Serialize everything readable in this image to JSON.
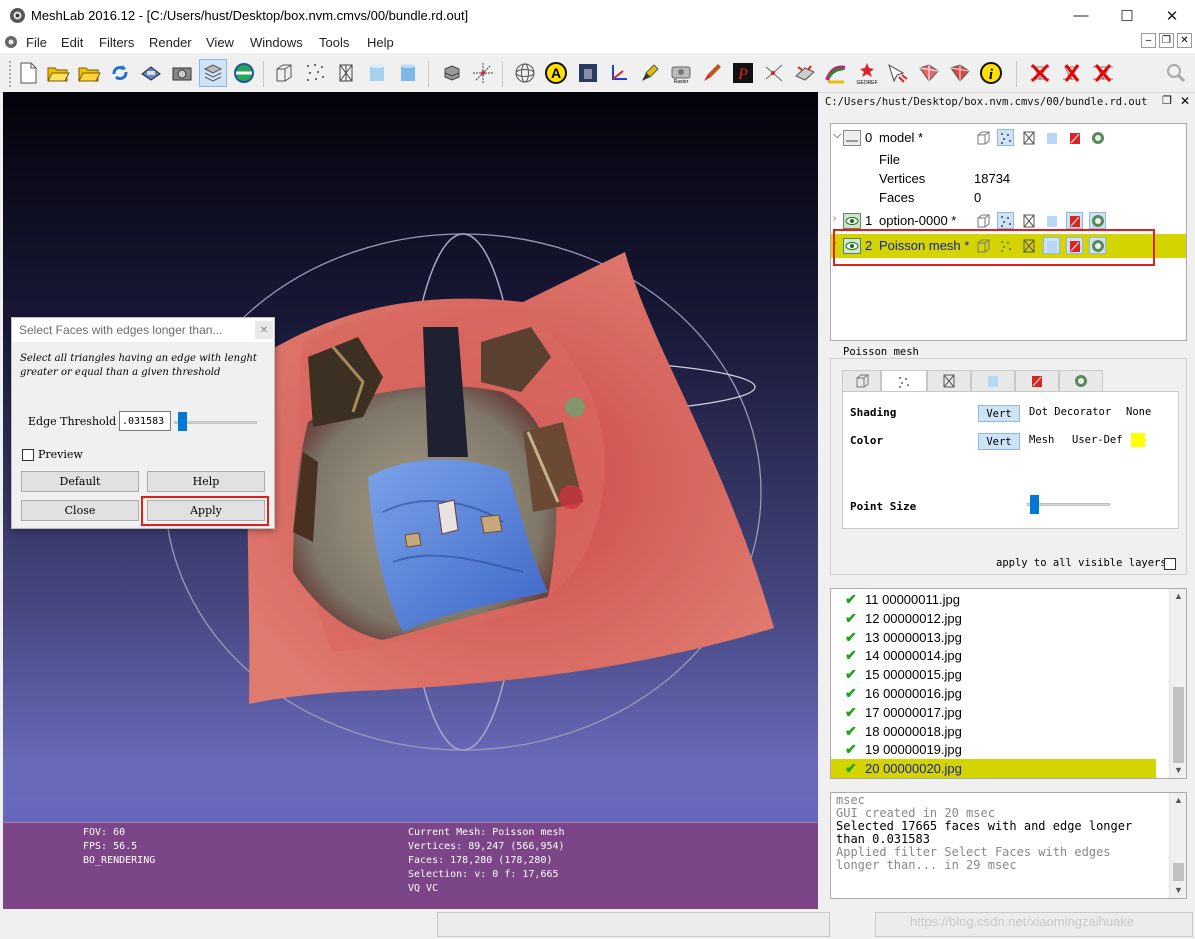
{
  "window": {
    "title": "MeshLab 2016.12 - [C:/Users/hust/Desktop/box.nvm.cmvs/00/bundle.rd.out]"
  },
  "menu": [
    "File",
    "Edit",
    "Filters",
    "Render",
    "View",
    "Windows",
    "Tools",
    "Help"
  ],
  "mdi_controls": [
    "–",
    "❐",
    "✕"
  ],
  "dialog": {
    "title": "Select Faces with edges longer than...",
    "close_glyph": "✕",
    "description": "Select all triangles having an edge with lenght greater or equal than a given threshold",
    "threshold_label": "Edge Threshold",
    "threshold_value": ".031583",
    "slider_fraction": 0.05,
    "preview_label": "Preview",
    "preview_checked": false,
    "default_label": "Default",
    "help_label": "Help",
    "close_label": "Close",
    "apply_label": "Apply"
  },
  "viewport_info": {
    "left": [
      "FOV: 60",
      "FPS:    56.5",
      "BO_RENDERING"
    ],
    "right": [
      "Current Mesh: Poisson mesh",
      "Vertices: 89,247    (566,954)",
      "Faces: 178,280    (178,280)",
      "Selection: v: 0 f: 17,665",
      "VQ VC"
    ]
  },
  "panel": {
    "path": "C:/Users/hust/Desktop/box.nvm.cmvs/00/bundle.rd.out",
    "layers": [
      {
        "id": "0",
        "name": "model *",
        "expanded": true,
        "details": [
          {
            "key": "File",
            "value": ""
          },
          {
            "key": "Vertices",
            "value": "18734"
          },
          {
            "key": "Faces",
            "value": "0"
          }
        ]
      },
      {
        "id": "1",
        "name": "option-0000 *",
        "expanded": false
      },
      {
        "id": "2",
        "name": "Poisson mesh *",
        "expanded": false,
        "selected": true
      }
    ],
    "render_group_title": "Poisson mesh",
    "shading_label": "Shading",
    "shading_options": [
      "Vert",
      "Dot Decorator",
      "None"
    ],
    "color_label": "Color",
    "color_options": [
      "Vert",
      "Mesh",
      "User-Def"
    ],
    "user_color": "#ffff00",
    "point_size_label": "Point Size",
    "point_size_fraction": 0.04,
    "apply_all_label": "apply to all visible layers"
  },
  "raster_list": [
    {
      "label": "11 00000011.jpg"
    },
    {
      "label": "12 00000012.jpg"
    },
    {
      "label": "13 00000013.jpg"
    },
    {
      "label": "14 00000014.jpg"
    },
    {
      "label": "15 00000015.jpg"
    },
    {
      "label": "16 00000016.jpg"
    },
    {
      "label": "17 00000017.jpg"
    },
    {
      "label": "18 00000018.jpg"
    },
    {
      "label": "19 00000019.jpg"
    },
    {
      "label": "20 00000020.jpg",
      "selected": true
    }
  ],
  "log": [
    "msec",
    "GUI created in 20 msec",
    "Selected 17665 faces with and edge longer",
    "than 0.031583",
    "Applied filter Select Faces with edges",
    "longer than... in 29 msec"
  ],
  "watermark": "https://blog.csdn.net/xiaomingzaihuake",
  "colors": {
    "highlight_magenta": "#ff00ff",
    "highlight_red": "#e0201a",
    "selection_yellow": "#d4d400",
    "info_bar": "#7b4587"
  }
}
